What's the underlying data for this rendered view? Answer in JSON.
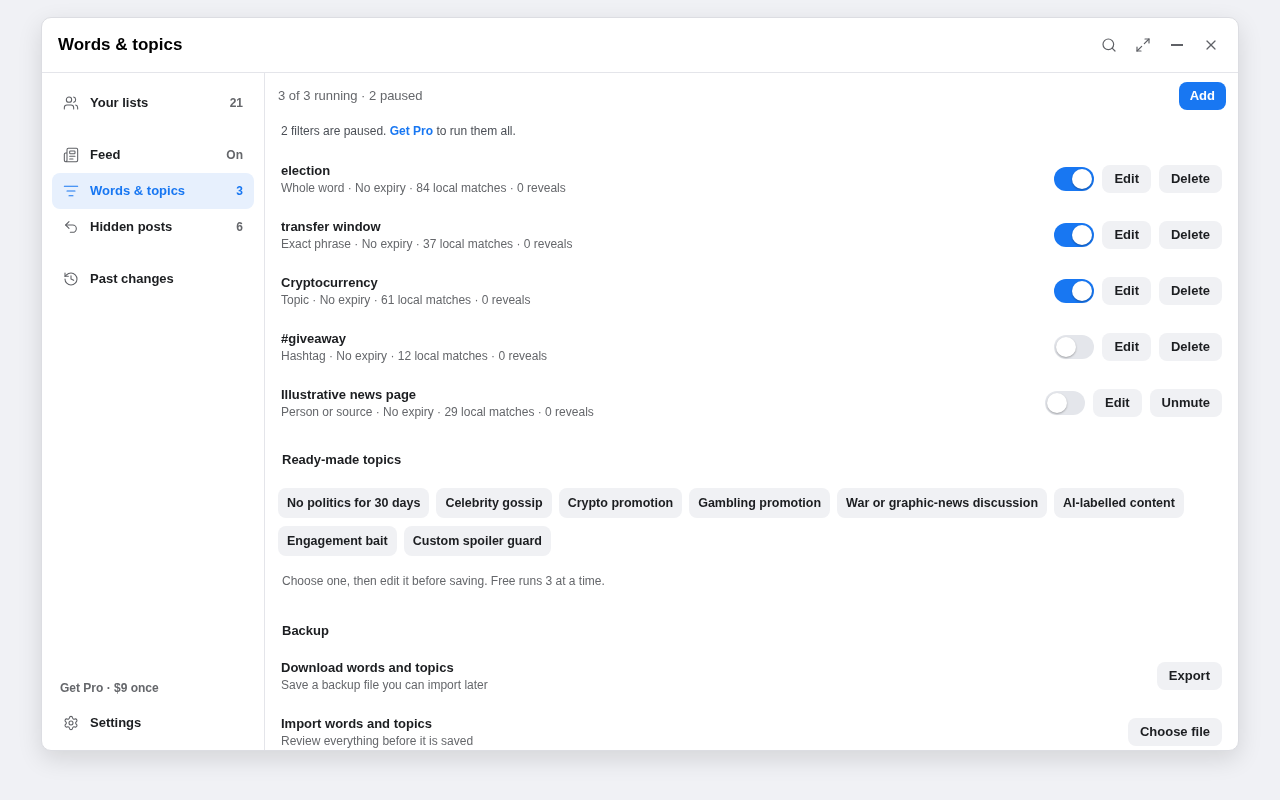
{
  "window": {
    "title": "Words & topics"
  },
  "sidebar": {
    "sections": [
      {
        "items": [
          {
            "label": "Your lists",
            "count": "21",
            "selected": false
          }
        ]
      },
      {
        "items": [
          {
            "label": "Feed",
            "count": "On",
            "selected": false
          },
          {
            "label": "Words & topics",
            "count": "3",
            "selected": true
          },
          {
            "label": "Hidden posts",
            "count": "6",
            "selected": false
          }
        ]
      },
      {
        "items": [
          {
            "label": "Past changes",
            "selected": false
          }
        ]
      }
    ],
    "promo": "Get Pro · $9 once",
    "footer_item": {
      "label": "Settings"
    }
  },
  "main": {
    "summary": "3 of 3 running · 2 paused",
    "add_button": "Add",
    "notice": {
      "before": "2 filters are paused.",
      "link": "Get Pro",
      "after": "to run them all."
    },
    "filters": [
      {
        "name": "election",
        "meta": "Whole word · No expiry · 84 local matches · 0 reveals",
        "on": true,
        "buttons": [
          "Edit",
          "Delete"
        ]
      },
      {
        "name": "transfer window",
        "meta": "Exact phrase · No expiry · 37 local matches · 0 reveals",
        "on": true,
        "buttons": [
          "Edit",
          "Delete"
        ]
      },
      {
        "name": "Cryptocurrency",
        "meta": "Topic · No expiry · 61 local matches · 0 reveals",
        "on": true,
        "buttons": [
          "Edit",
          "Delete"
        ]
      },
      {
        "name": "#giveaway",
        "meta": "Hashtag · No expiry · 12 local matches · 0 reveals",
        "on": false,
        "buttons": [
          "Edit",
          "Delete"
        ]
      },
      {
        "name": "Illustrative news page",
        "meta": "Person or source · No expiry · 29 local matches · 0 reveals",
        "on": false,
        "buttons": [
          "Edit",
          "Unmute"
        ]
      }
    ],
    "ready_made": {
      "heading": "Ready-made topics",
      "topics": [
        "No politics for 30 days",
        "Celebrity gossip",
        "Crypto promotion",
        "Gambling promotion",
        "War or graphic-news discussion",
        "AI-labelled content",
        "Engagement bait",
        "Custom spoiler guard"
      ],
      "hint": "Choose one, then edit it before saving. Free runs 3 at a time."
    },
    "backup": {
      "heading": "Backup",
      "rows": [
        {
          "title": "Download words and topics",
          "subtitle": "Save a backup file you can import later",
          "button": "Export"
        },
        {
          "title": "Import words and topics",
          "subtitle": "Review everything before it is saved",
          "button": "Choose file"
        }
      ]
    }
  }
}
